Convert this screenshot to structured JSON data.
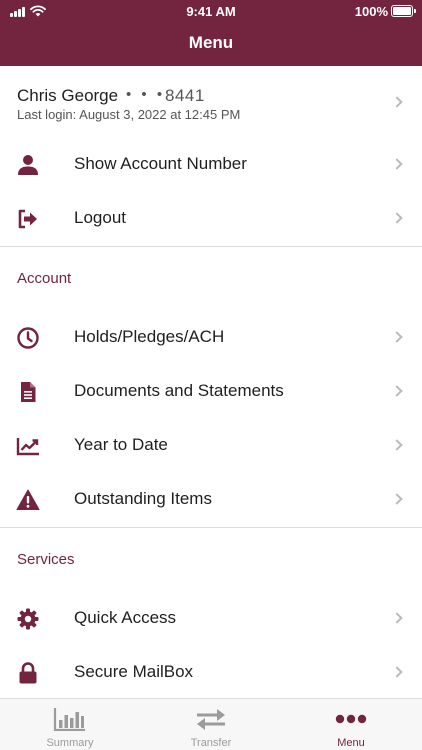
{
  "status_bar": {
    "time": "9:41 AM",
    "battery": "100%"
  },
  "header": {
    "title": "Menu"
  },
  "user": {
    "name": "Chris George",
    "masked_dots": "• • •",
    "account_suffix": "8441",
    "last_login": "Last login: August 3, 2022 at 12:45 PM"
  },
  "top_items": [
    {
      "label": "Show Account Number",
      "icon": "person-icon"
    },
    {
      "label": "Logout",
      "icon": "logout-icon"
    }
  ],
  "account_section": {
    "title": "Account",
    "items": [
      {
        "label": "Holds/Pledges/ACH",
        "icon": "clock-icon"
      },
      {
        "label": "Documents and Statements",
        "icon": "document-icon"
      },
      {
        "label": "Year to Date",
        "icon": "trend-chart-icon"
      },
      {
        "label": "Outstanding Items",
        "icon": "warning-icon"
      }
    ]
  },
  "services_section": {
    "title": "Services",
    "items": [
      {
        "label": "Quick Access",
        "icon": "gear-icon"
      },
      {
        "label": "Secure MailBox",
        "icon": "lock-icon"
      }
    ]
  },
  "tab_bar": {
    "tabs": [
      {
        "label": "Summary",
        "icon": "bar-chart-icon"
      },
      {
        "label": "Transfer",
        "icon": "transfer-arrows-icon"
      },
      {
        "label": "Menu",
        "icon": "more-dots-icon",
        "active": true
      }
    ]
  },
  "colors": {
    "brand": "#73243f",
    "chevron": "#b9b9b9",
    "inactive_tab": "#9b9b9b"
  }
}
